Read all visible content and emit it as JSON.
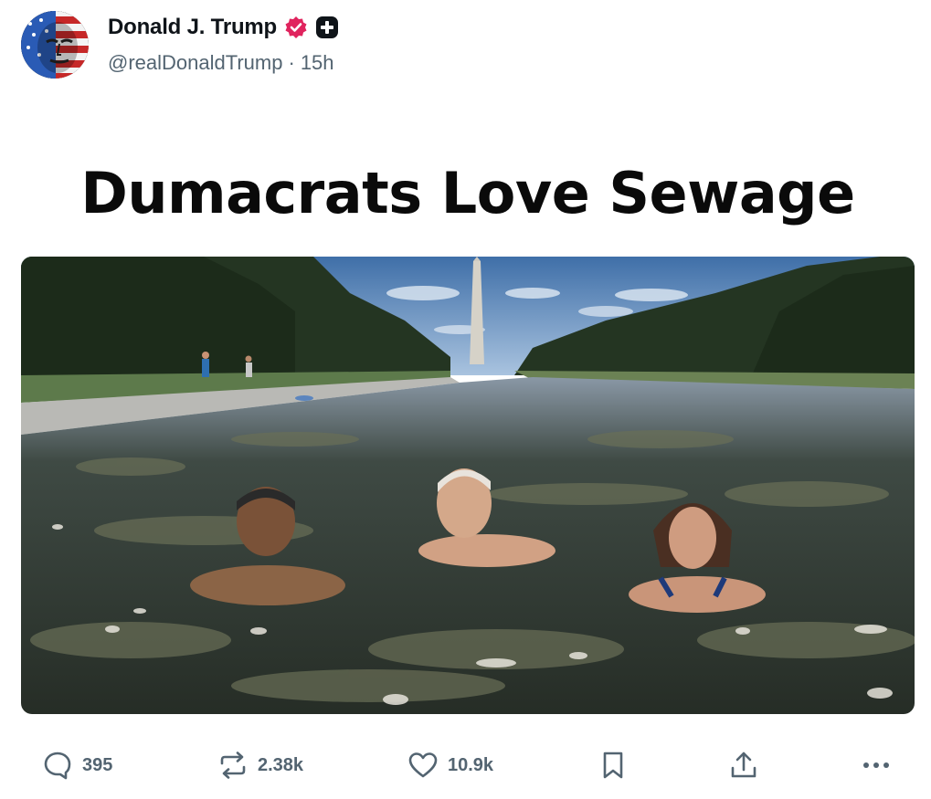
{
  "author": {
    "display_name": "Donald J. Trump",
    "handle": "@realDonaldTrump",
    "separator": "·",
    "time_ago": "15h",
    "avatar_icon": "flag-face-avatar",
    "verified_icon": "verified-badge-icon",
    "verified_color": "#e0245e",
    "affiliate_icon": "plus-badge-icon"
  },
  "media": {
    "title_text": "Dumacrats Love Sewage",
    "image_icon": "ai-generated-photo-reflecting-pool"
  },
  "actions": {
    "reply": {
      "icon": "reply-icon",
      "count": "395"
    },
    "repost": {
      "icon": "repost-icon",
      "count": "2.38k"
    },
    "like": {
      "icon": "heart-icon",
      "count": "10.9k"
    },
    "bookmark": {
      "icon": "bookmark-icon"
    },
    "share": {
      "icon": "share-icon"
    },
    "more": {
      "icon": "more-icon"
    }
  },
  "colors": {
    "text_primary": "#0f1419",
    "text_secondary": "#536471"
  }
}
